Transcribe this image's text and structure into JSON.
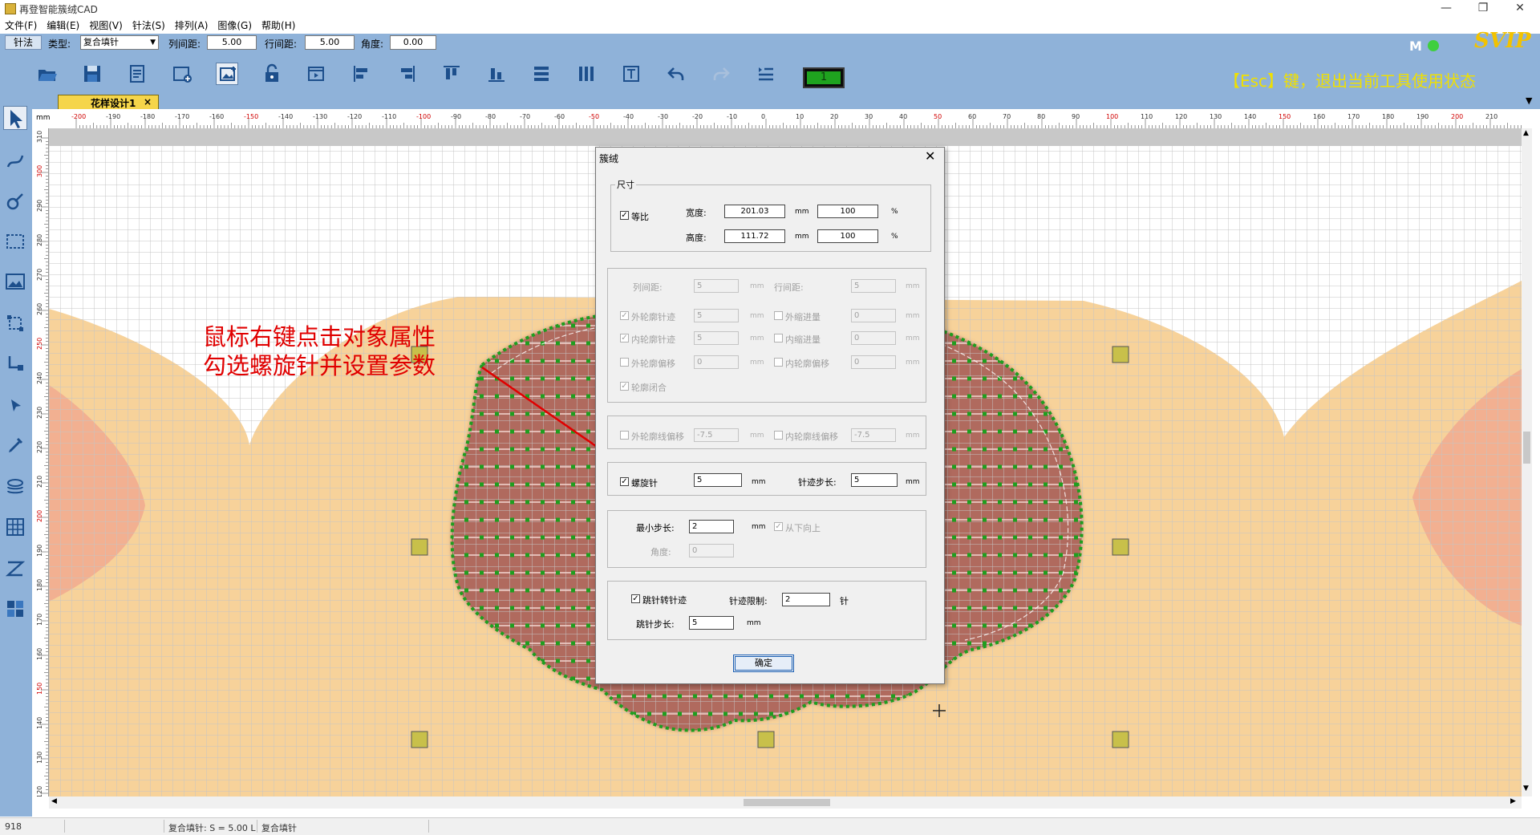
{
  "window": {
    "title": "再登智能簇绒CAD",
    "controls": [
      "—",
      "❐",
      "✕"
    ]
  },
  "menu": [
    "文件(F)",
    "编辑(E)",
    "视图(V)",
    "针法(S)",
    "排列(A)",
    "图像(G)",
    "帮助(H)"
  ],
  "options_bar": {
    "tab": "针法",
    "type_label": "类型:",
    "type_value": "复合填针",
    "col_spacing_label": "列间距:",
    "col_spacing_value": "5.00",
    "row_spacing_label": "行间距:",
    "row_spacing_value": "5.00",
    "angle_label": "角度:",
    "angle_value": "0.00"
  },
  "toolbar": {
    "counter": "1",
    "esc_hint": "【Esc】键，退出当前工具使用状态",
    "mode_indicator": "M",
    "vip_badge": "SVIP"
  },
  "doc_tab": {
    "label": "花样设计1",
    "close": "×"
  },
  "ruler": {
    "unit": "mm",
    "h_labels": [
      "-200",
      "-190",
      "-180",
      "-170",
      "-160",
      "-150",
      "-140",
      "-130",
      "-120",
      "-110",
      "-100",
      "-90",
      "-80",
      "-70",
      "-60",
      "-50",
      "-40",
      "-30",
      "-20",
      "-10",
      "0",
      "10",
      "20",
      "30",
      "40",
      "50",
      "60",
      "70",
      "80",
      "90",
      "100",
      "110",
      "120",
      "130",
      "140",
      "150",
      "160",
      "170",
      "180",
      "190",
      "200",
      "210"
    ],
    "v_labels": [
      "310",
      "300",
      "290",
      "280",
      "270",
      "260",
      "250",
      "240",
      "230",
      "220",
      "210",
      "200",
      "190",
      "180",
      "170",
      "160",
      "150",
      "140",
      "130",
      "120"
    ]
  },
  "annotation": {
    "line1": "鼠标右键点击对象属性",
    "line2": "勾选螺旋针并设置参数"
  },
  "dialog": {
    "title": "簇绒",
    "size_group": "尺寸",
    "proportional": "等比",
    "width_label": "宽度:",
    "width_value": "201.03",
    "width_pct": "100",
    "height_label": "高度:",
    "height_value": "111.72",
    "height_pct": "100",
    "unit_mm": "mm",
    "unit_pct": "%",
    "col_spacing_label": "列间距:",
    "col_spacing_value": "5",
    "row_spacing_label": "行间距:",
    "row_spacing_value": "5",
    "outer_contour_label": "外轮廓针迹",
    "outer_contour_value": "5",
    "outer_shrink_label": "外缩进量",
    "outer_shrink_value": "0",
    "inner_contour_label": "内轮廓针迹",
    "inner_contour_value": "5",
    "inner_shrink_label": "内缩进量",
    "inner_shrink_value": "0",
    "outer_offset_label": "外轮廓偏移",
    "outer_offset_value": "0",
    "inner_offset_label": "内轮廓偏移",
    "inner_offset_value": "0",
    "contour_closed_label": "轮廓闭合",
    "outer_line_offset_label": "外轮廓线偏移",
    "outer_line_offset_value": "-7.5",
    "inner_line_offset_label": "内轮廓线偏移",
    "inner_line_offset_value": "-7.5",
    "spiral_label": "螺旋针",
    "spiral_value": "5",
    "stitch_step_label": "针迹步长:",
    "stitch_step_value": "5",
    "min_step_label": "最小步长:",
    "min_step_value": "2",
    "bottom_up_label": "从下向上",
    "angle_label": "角度:",
    "angle_value": "0",
    "jump_to_stitch_label": "跳针转针迹",
    "stitch_limit_label": "针迹限制:",
    "stitch_limit_value": "2",
    "stitch_limit_unit": "针",
    "jump_step_label": "跳针步长:",
    "jump_step_value": "5",
    "ok_label": "确定"
  },
  "status": {
    "coord": "918",
    "stitch_info": "复合填针: S = 5.00 L",
    "mode": "复合填针"
  },
  "colors": {
    "toolbar_bg": "#8fb2d9",
    "shape_fill": "#b06a5e",
    "stitch_green": "#1f9e1f",
    "background_fill": "#f7d29a",
    "annotation_red": "#e00000",
    "handle": "#c8c04a"
  }
}
